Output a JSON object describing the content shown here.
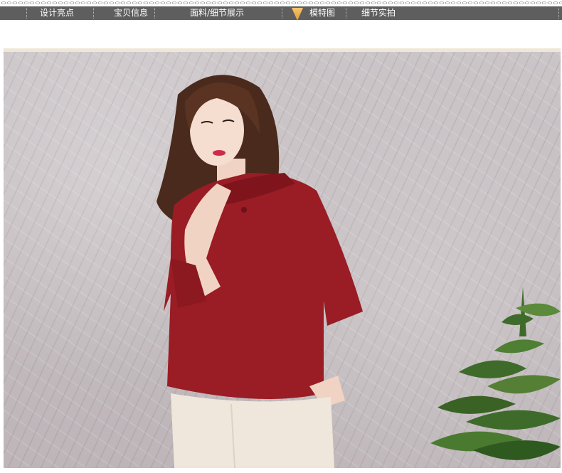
{
  "nav": {
    "items": [
      {
        "label": "设计亮点"
      },
      {
        "label": "宝贝信息"
      },
      {
        "label": "面料/细节展示"
      },
      {
        "label": "模特图"
      },
      {
        "label": "细节实拍"
      }
    ],
    "active_index": 3
  },
  "colors": {
    "nav_bg": "#5e5e5e",
    "active_marker": "#e5a44a",
    "frame": "#efe6d7",
    "shirt": "#9a1c24",
    "pants": "#efe6dc"
  },
  "photo": {
    "icon": "model-photo"
  }
}
